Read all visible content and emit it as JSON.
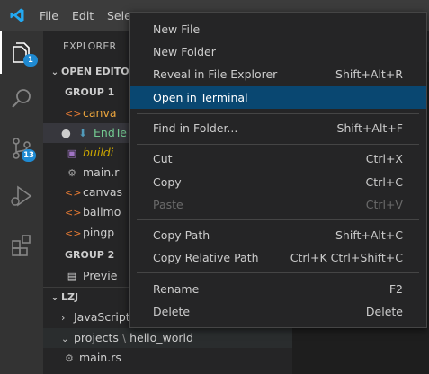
{
  "titlebar": {
    "menus": [
      "File",
      "Edit",
      "Sele"
    ]
  },
  "activity": {
    "explorer_badge": "1",
    "scm_badge": "13"
  },
  "sidebar": {
    "title": "EXPLORER",
    "open_editors": {
      "header": "OPEN EDITOR",
      "group1": "GROUP 1",
      "group1_files": [
        {
          "icon": "<>",
          "name": "canva",
          "color": "#e8a33d"
        },
        {
          "icon": "⬇",
          "name": "EndTe",
          "color": "#73c991"
        },
        {
          "icon": "▣",
          "name": "buildi",
          "color": "#cca700"
        },
        {
          "icon": "⚙",
          "name": "main.r",
          "color": "#cccccc"
        },
        {
          "icon": "<>",
          "name": "canvas",
          "color": "#cccccc"
        },
        {
          "icon": "<>",
          "name": "ballmo",
          "color": "#cccccc"
        },
        {
          "icon": "<>",
          "name": "pingp",
          "color": "#cccccc"
        }
      ],
      "group2": "GROUP 2",
      "group2_files": [
        {
          "icon": "▤",
          "name": "Previe"
        }
      ]
    },
    "workspace": {
      "header": "LZJ",
      "items": [
        {
          "label": "JavaScript"
        },
        {
          "label_a": "projects",
          "sep": "\\",
          "label_b": "hello_world"
        },
        {
          "label": "main.rs"
        }
      ]
    }
  },
  "context_menu": {
    "items": [
      {
        "label": "New File",
        "shortcut": ""
      },
      {
        "label": "New Folder",
        "shortcut": ""
      },
      {
        "label": "Reveal in File Explorer",
        "shortcut": "Shift+Alt+R"
      },
      {
        "label": "Open in Terminal",
        "shortcut": ""
      },
      {
        "label": "Find in Folder...",
        "shortcut": "Shift+Alt+F"
      },
      {
        "label": "Cut",
        "shortcut": "Ctrl+X"
      },
      {
        "label": "Copy",
        "shortcut": "Ctrl+C"
      },
      {
        "label": "Paste",
        "shortcut": "Ctrl+V"
      },
      {
        "label": "Copy Path",
        "shortcut": "Shift+Alt+C"
      },
      {
        "label": "Copy Relative Path",
        "shortcut": "Ctrl+K Ctrl+Shift+C"
      },
      {
        "label": "Rename",
        "shortcut": "F2"
      },
      {
        "label": "Delete",
        "shortcut": "Delete"
      }
    ]
  },
  "colors": {
    "accent": "#007acc",
    "highlight": "#094771",
    "badge": "#1f8ad2"
  }
}
